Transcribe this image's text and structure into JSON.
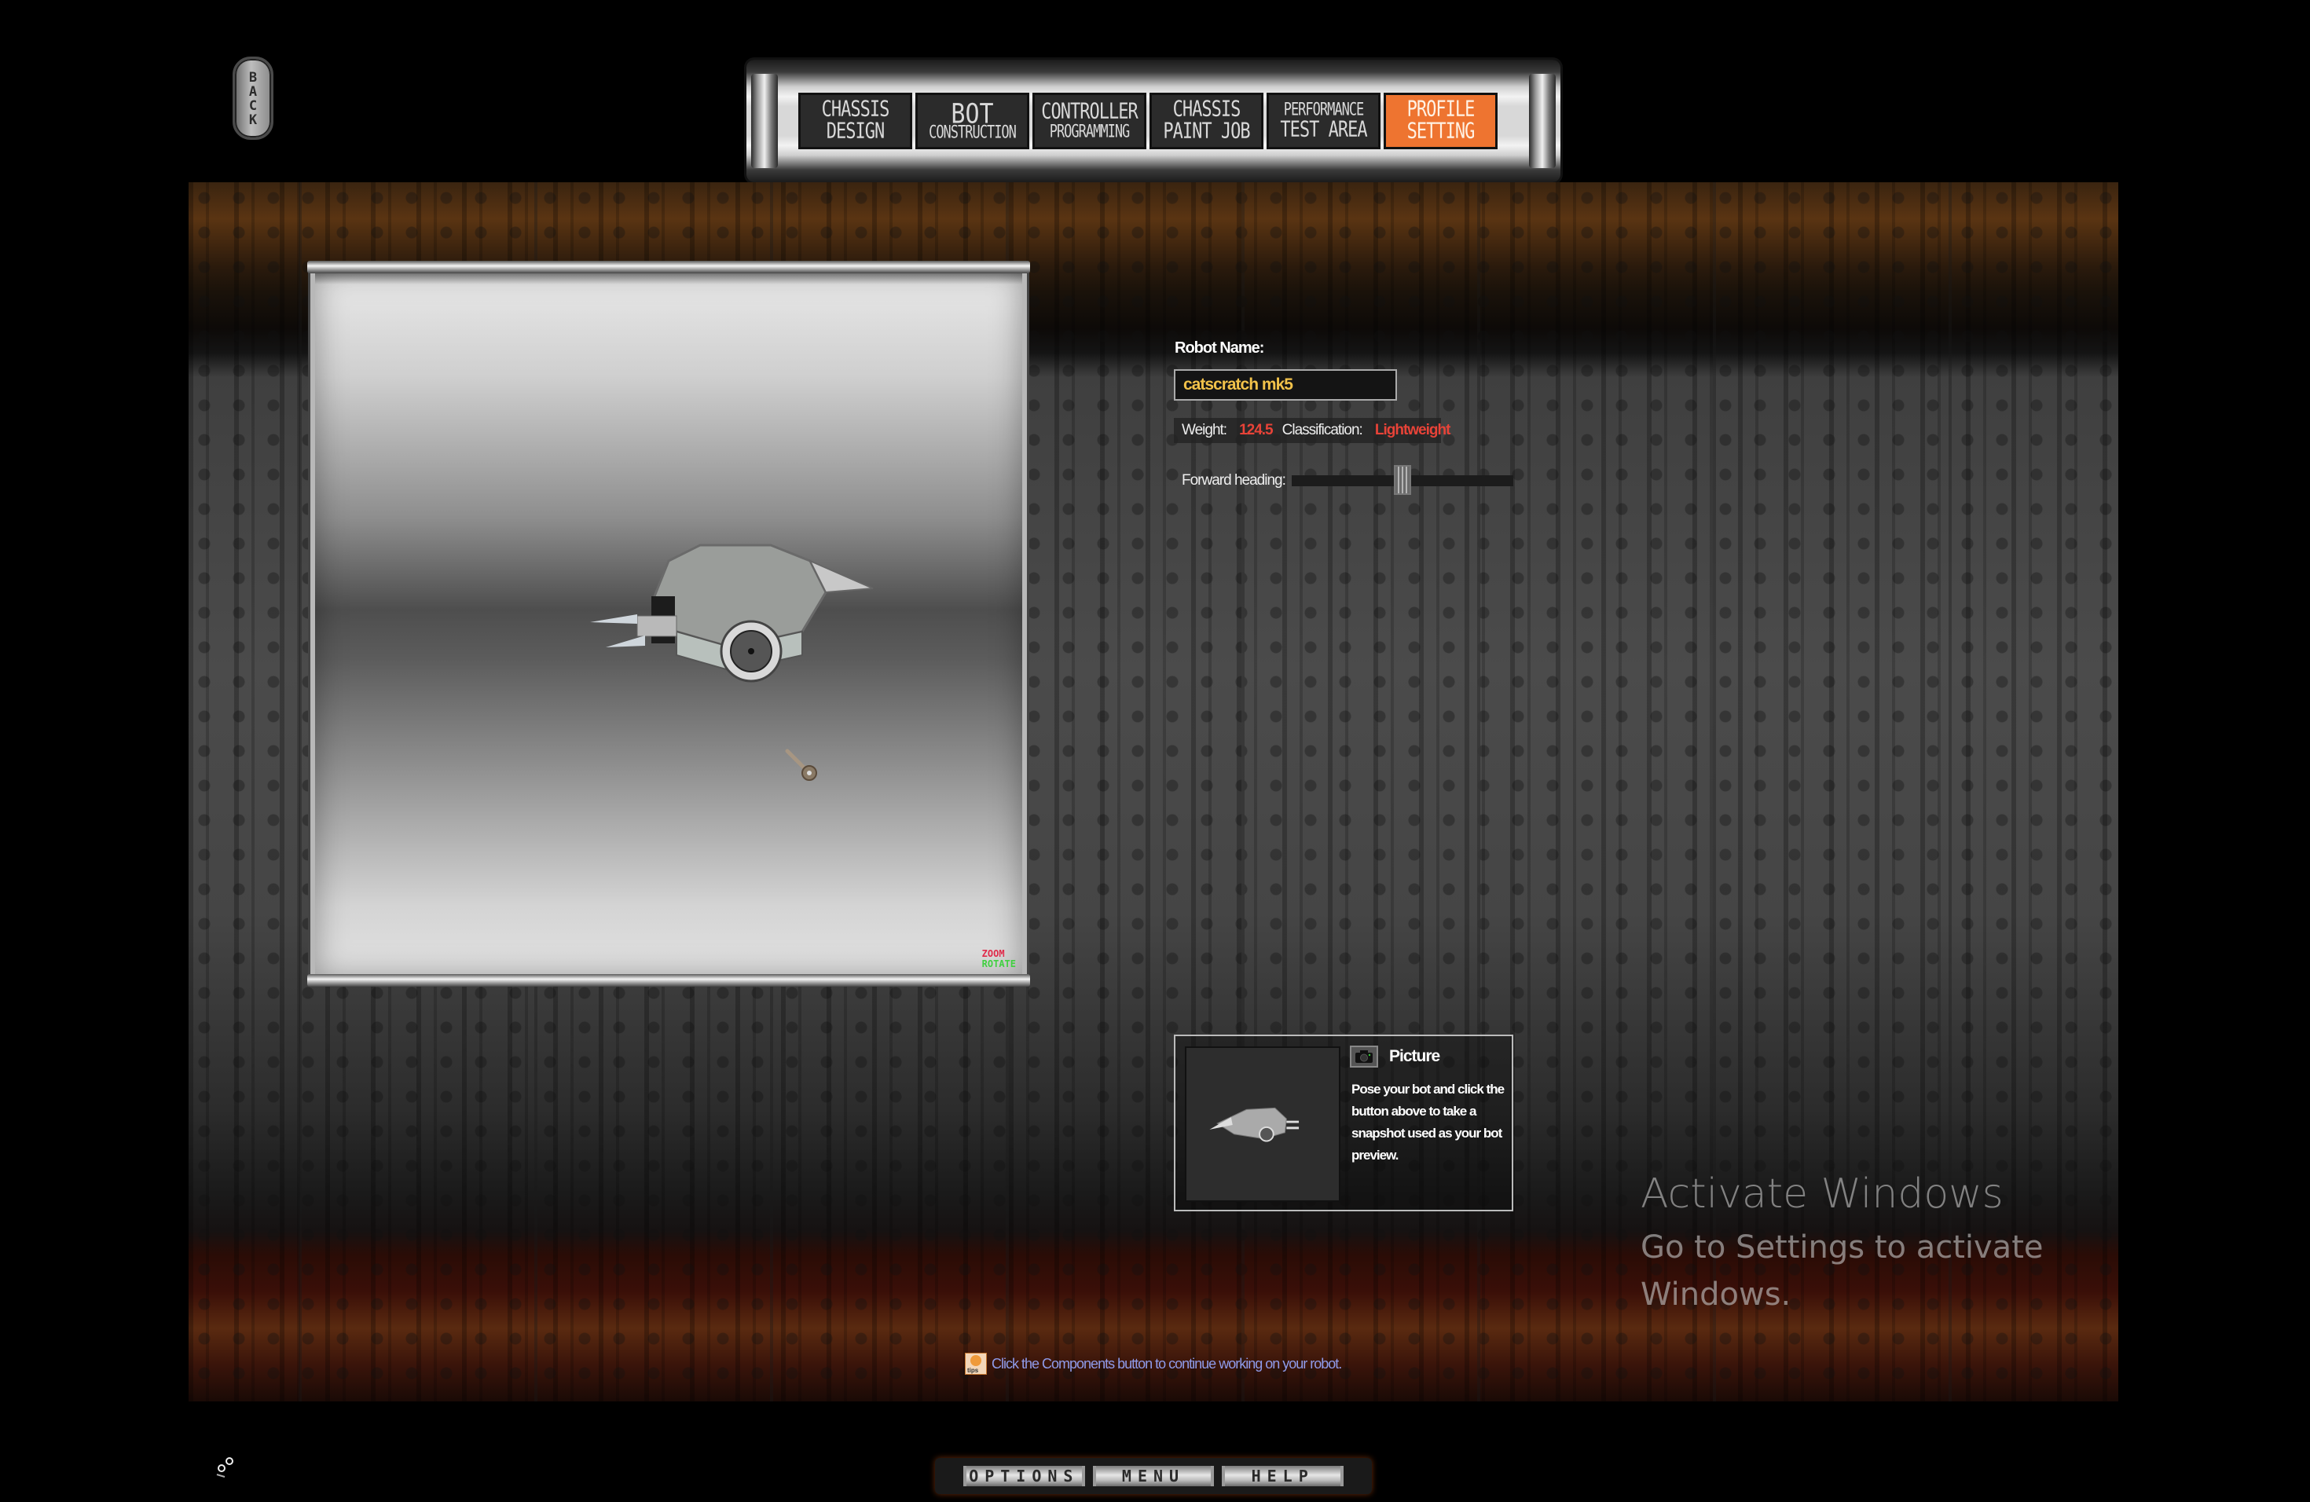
{
  "back_button": {
    "label": "BACK"
  },
  "nav": {
    "tabs": [
      {
        "line1": "CHASSIS",
        "line2": "DESIGN",
        "active": false
      },
      {
        "line1": "BOT",
        "line2": "CONSTRUCTION",
        "active": false
      },
      {
        "line1": "CONTROLLER",
        "line2": "PROGRAMMING",
        "active": false
      },
      {
        "line1": "CHASSIS",
        "line2": "PAINT JOB",
        "active": false
      },
      {
        "line1": "PERFORMANCE",
        "line2": "TEST AREA",
        "active": false
      },
      {
        "line1": "PROFILE",
        "line2": "SETTING",
        "active": true
      }
    ],
    "active_color": "#ee7430"
  },
  "viewer": {
    "hint_zoom": "ZOOM",
    "hint_rotate": "ROTATE"
  },
  "profile": {
    "robot_name_label": "Robot Name:",
    "robot_name_value": "catscratch mk5",
    "weight_label": "Weight:",
    "weight_value": "124.5",
    "classification_label": "Classification:",
    "classification_value": "Lightweight",
    "forward_heading_label": "Forward heading:",
    "forward_heading_fraction": 0.5,
    "value_color": "#e84338",
    "name_color": "#f2c24a"
  },
  "picture": {
    "title": "Picture",
    "description": "Pose your bot and click the button above to take a snapshot used as your bot preview."
  },
  "tip": {
    "icon_label": "tips",
    "text": "Click the Components button to continue working on your robot."
  },
  "activation_watermark": {
    "title": "Activate Windows",
    "subtitle": "Go to Settings to activate Windows."
  },
  "bottom_nav": {
    "options": "OPTIONS",
    "menu": "MENU",
    "help": "HELP"
  }
}
